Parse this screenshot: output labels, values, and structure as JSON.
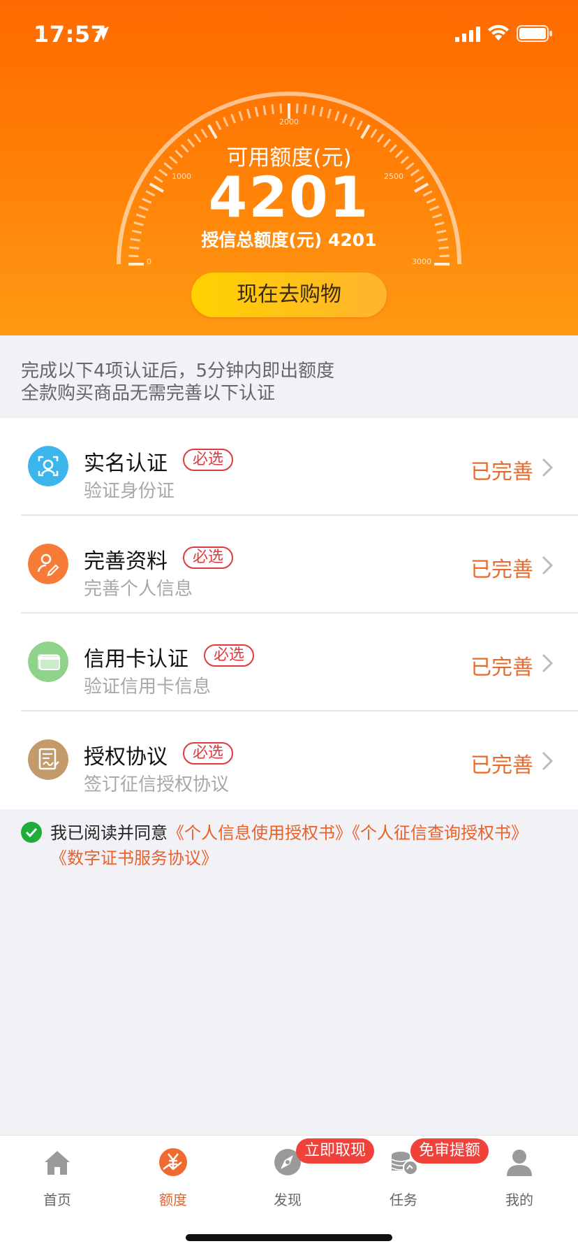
{
  "status_bar": {
    "time": "17:57"
  },
  "credit": {
    "available_label": "可用额度(元)",
    "available_value": "4201",
    "total_text": "授信总额度(元) 4201",
    "gauge_ticks": [
      "0",
      "1000",
      "2000",
      "2500",
      "3000"
    ],
    "shop_button": "现在去购物"
  },
  "notice": {
    "line1": "完成以下4项认证后，5分钟内即出额度",
    "line2": "全款购买商品无需完善以下认证"
  },
  "certifications": [
    {
      "title": "实名认证",
      "badge": "必选",
      "desc": "验证身份证",
      "status": "已完善",
      "icon": "face-id-icon",
      "color": "#3bb5ec"
    },
    {
      "title": "完善资料",
      "badge": "必选",
      "desc": "完善个人信息",
      "status": "已完善",
      "icon": "profile-edit-icon",
      "color": "#f57b37"
    },
    {
      "title": "信用卡认证",
      "badge": "必选",
      "desc": "验证信用卡信息",
      "status": "已完善",
      "icon": "credit-card-icon",
      "color": "#8fd28a"
    },
    {
      "title": "授权协议",
      "badge": "必选",
      "desc": "签订征信授权协议",
      "status": "已完善",
      "icon": "contract-icon",
      "color": "#c29a6b"
    }
  ],
  "agreement": {
    "prefix": "我已阅读并同意",
    "link1": "《个人信息使用授权书》",
    "link2": "《个人征信查询授权书》",
    "link3": "《数字证书服务协议》"
  },
  "tabbar": {
    "tabs": [
      {
        "label": "首页",
        "icon": "home-icon"
      },
      {
        "label": "额度",
        "icon": "yen-icon"
      },
      {
        "label": "发现",
        "icon": "compass-icon"
      },
      {
        "label": "任务",
        "icon": "coins-icon"
      },
      {
        "label": "我的",
        "icon": "user-icon"
      }
    ],
    "active": "额度",
    "badge_discover": "立即取现",
    "badge_task": "免审提额"
  },
  "colors": {
    "accent": "#e8612b",
    "header": "#ff7d05",
    "badge": "#e0393e"
  }
}
